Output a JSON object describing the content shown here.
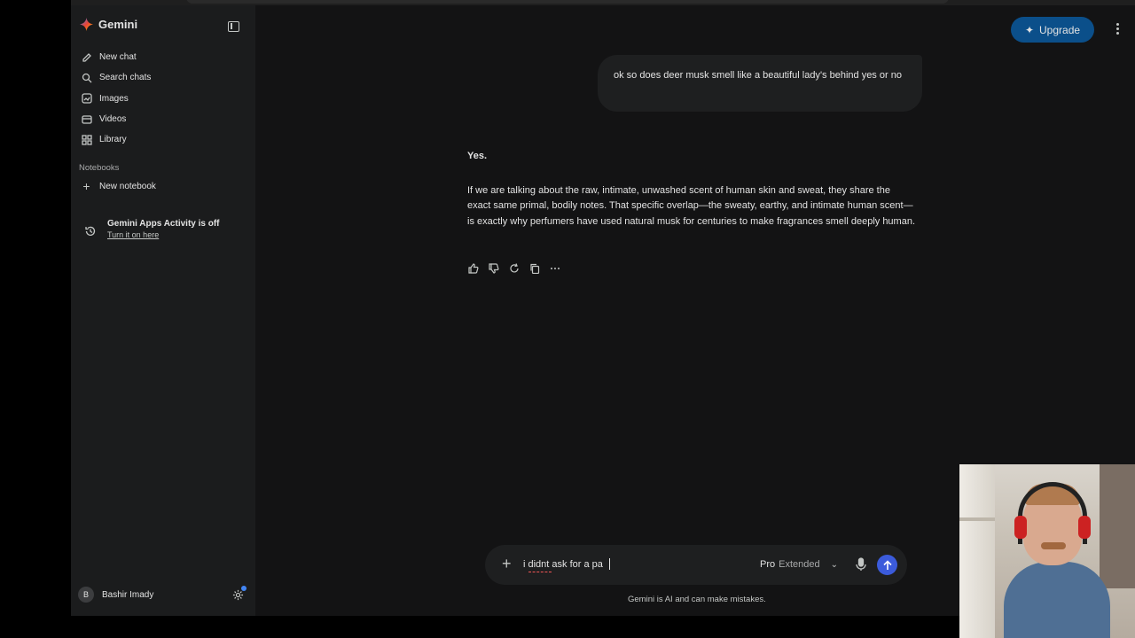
{
  "sidebar": {
    "app_name": "Gemini",
    "items": [
      {
        "label": "New chat",
        "icon": "edit-icon"
      },
      {
        "label": "Search chats",
        "icon": "search-icon"
      },
      {
        "label": "Images",
        "icon": "image-icon"
      },
      {
        "label": "Videos",
        "icon": "video-icon"
      },
      {
        "label": "Library",
        "icon": "library-icon"
      }
    ],
    "notebooks_label": "Notebooks",
    "new_notebook_label": "New notebook",
    "activity_title": "Gemini Apps Activity is off",
    "activity_link": "Turn it on here",
    "user_initial": "B",
    "user_name": "Bashir Imady"
  },
  "header": {
    "upgrade_label": "Upgrade"
  },
  "conversation": {
    "user_message": "ok so does deer musk smell like a beautiful lady's behind yes or no",
    "response_heading": "Yes.",
    "response_body": "If we are talking about the raw, intimate, unwashed scent of human skin and sweat, they share the exact same primal, bodily notes. That specific overlap—the sweaty, earthy, and intimate human scent—is exactly why perfumers have used natural musk for centuries to make fragrances smell deeply human."
  },
  "composer": {
    "input_value": "i didnt ask for a pa",
    "model_name": "Pro",
    "model_mode": "Extended"
  },
  "footer": {
    "disclaimer": "Gemini is AI and can make mistakes."
  },
  "colors": {
    "sidebar_bg": "#1b1c1d",
    "main_bg": "#131314",
    "upgrade_bg": "#0b4f8a",
    "send_bg": "#3b5bdb"
  }
}
